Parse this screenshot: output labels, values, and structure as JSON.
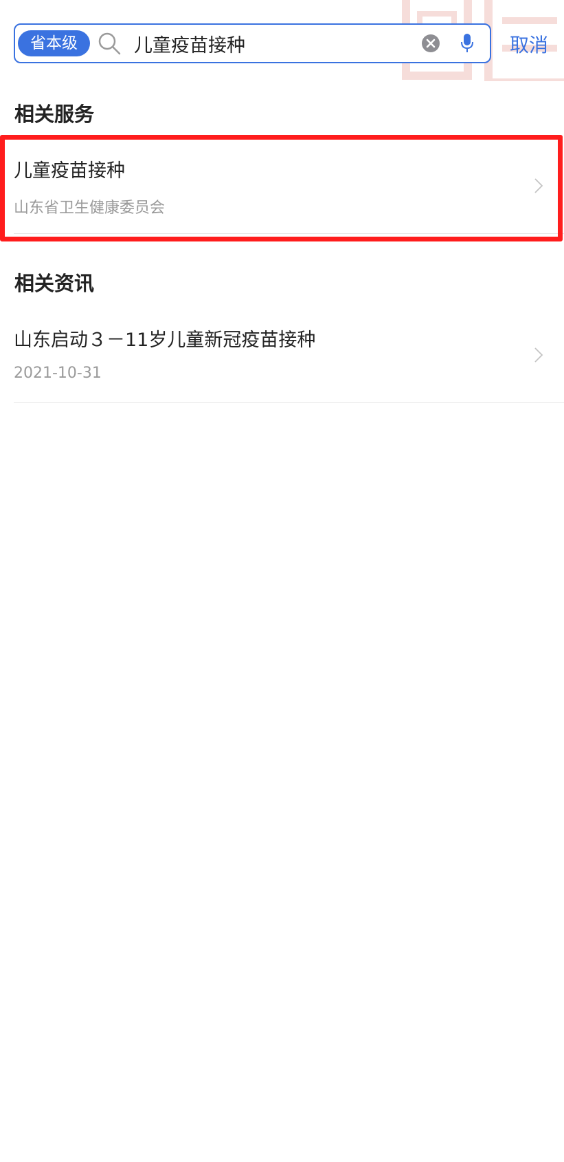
{
  "search": {
    "scope_label": "省本级",
    "query": "儿童疫苗接种",
    "cancel_label": "取消"
  },
  "sections": {
    "services": {
      "title": "相关服务",
      "items": [
        {
          "title": "儿童疫苗接种",
          "subtitle": "山东省卫生健康委员会"
        }
      ]
    },
    "news": {
      "title": "相关资讯",
      "items": [
        {
          "title": "山东启动３－11岁儿童新冠疫苗接种",
          "date": "2021-10-31"
        }
      ]
    }
  },
  "colors": {
    "accent": "#3a72e0",
    "highlight": "#ff1d1d",
    "secondary_text": "#9a9a9a"
  },
  "icons": {
    "search": "search-icon",
    "clear": "clear-icon",
    "mic": "mic-icon",
    "chevron": "chevron-right-icon"
  }
}
